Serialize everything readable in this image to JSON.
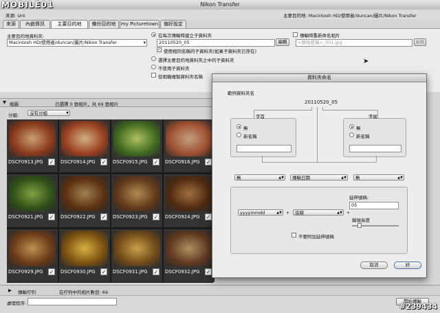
{
  "window": {
    "title": "Nikon Transfer"
  },
  "logo": "MOBILE01",
  "status": {
    "source_prefix": "來源:",
    "source_val": "Unt",
    "dest_label": "主要目的地: Macintosh HD/使用者/duncan/圖片/Nikon Transfer"
  },
  "tabs": [
    {
      "label": "來源"
    },
    {
      "label": "內嵌資訊"
    },
    {
      "label": "主要目的地"
    },
    {
      "label": "備份目的地"
    },
    {
      "label": "my Picturetown"
    },
    {
      "label": "偏好設定"
    }
  ],
  "primary": {
    "folder_label": "主要目的地資料夾:",
    "folder_value": "Macintosh HD/使用者/duncan/圖片/Nikon Transfer",
    "create_sub": "在每次傳輸時建立子資料夾",
    "sub_value": "20110520_05",
    "edit_btn": "編輯",
    "use_same": "使用相同名稱的子資料夾(如果子資料夾已存在)",
    "opt_choose": "選擇主要目的地資料夾之中的子資料夾",
    "opt_none": "不使用子資料夾",
    "copy_name": "從相機複製資料夾名稱",
    "rename_label": "傳輸時重新命名相片",
    "rename_value": "<原始名稱>_001.jpg",
    "rename_edit": "編輯"
  },
  "thumb_header": {
    "section": "縮圖",
    "selected": "已選擇 0 張相片，共 69 張相片"
  },
  "group": {
    "label": "分組:",
    "value": "沒有分組"
  },
  "thumbnails": [
    {
      "name": "DSCF0913.JPG",
      "c1": "#c8a070",
      "c2": "#8a3a1a"
    },
    {
      "name": "DSCF0914.JPG",
      "c1": "#d0b080",
      "c2": "#9a4020"
    },
    {
      "name": "DSCF0915.JPG",
      "c1": "#b0c060",
      "c2": "#406a20"
    },
    {
      "name": "DSCF0916.JPG",
      "c1": "#c0a080",
      "c2": "#a05030"
    },
    {
      "name": "DSCF0921.JPG",
      "c1": "#80a040",
      "c2": "#305018"
    },
    {
      "name": "DSCF0922.JPG",
      "c1": "#a08050",
      "c2": "#5a3010"
    },
    {
      "name": "DSCF0923.JPG",
      "c1": "#b08a50",
      "c2": "#60381a"
    },
    {
      "name": "DSCF0924.JPG",
      "c1": "#a07040",
      "c2": "#502a10"
    },
    {
      "name": "DSCF0929.JPG",
      "c1": "#c09050",
      "c2": "#6a3a18"
    },
    {
      "name": "DSCF0930.JPG",
      "c1": "#d8b040",
      "c2": "#7a5010"
    },
    {
      "name": "DSCF0931.JPG",
      "c1": "#c8a048",
      "c2": "#704a18"
    },
    {
      "name": "DSCF0932.JPG",
      "c1": "#b09060",
      "c2": "#603820"
    }
  ],
  "queue": {
    "label": "傳輸佇列",
    "count": "在佇列中的相片數目: 69"
  },
  "process": {
    "label": "處理程序:",
    "start_btn": "開始傳輸"
  },
  "watermark": "#2394​34",
  "dialog": {
    "title": "資料夾命名",
    "example_label": "範例資料夾名",
    "example_value": "20110520_05",
    "prefix": {
      "label": "字首",
      "none": "無",
      "new_name": "新名稱"
    },
    "suffix": {
      "label": "字尾",
      "none": "無",
      "new_name": "新名稱"
    },
    "pop1": "無",
    "pop2": "傳輸日期",
    "pop3": "無",
    "extend_label": "延伸號碼:",
    "extend_value": "05",
    "date_format": "yyyymmdd",
    "sep_label": "底線",
    "length_label": "編號長度",
    "no_extend": "不要附加延伸號碼",
    "cancel": "取消",
    "ok": "好"
  }
}
